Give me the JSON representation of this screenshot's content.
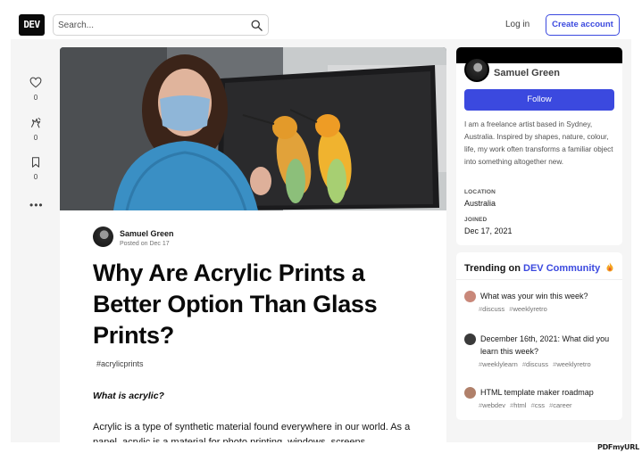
{
  "header": {
    "logo": "DEV",
    "search_placeholder": "Search...",
    "login_label": "Log in",
    "create_account_label": "Create account"
  },
  "reactions": [
    {
      "icon": "heart-icon",
      "count": "0"
    },
    {
      "icon": "unicorn-icon",
      "count": "0"
    },
    {
      "icon": "bookmark-icon",
      "count": "0"
    }
  ],
  "more_label": "•••",
  "article": {
    "author_name": "Samuel Green",
    "posted": "Posted on Dec 17",
    "title": "Why Are Acrylic Prints a Better Option Than Glass Prints?",
    "tag": "#acrylicprints",
    "subheading": "What is acrylic?",
    "body": "Acrylic is a type of synthetic material found everywhere in our world. As a panel, acrylic is a material for photo printing, windows, screens"
  },
  "profile": {
    "name": "Samuel Green",
    "follow_label": "Follow",
    "bio": "I am a freelance artist based in Sydney, Australia. Inspired by shapes, nature, colour, life, my work often transforms a familiar object into something altogether new.",
    "location_label": "LOCATION",
    "location": "Australia",
    "joined_label": "JOINED",
    "joined": "Dec 17, 2021"
  },
  "trending": {
    "prefix": "Trending on",
    "brand": "DEV Community",
    "items": [
      {
        "title": "What was your win this week?",
        "tags": [
          "discuss",
          "weeklyretro"
        ],
        "avatar_color": "#c9887a"
      },
      {
        "title": "December 16th, 2021: What did you learn this week?",
        "tags": [
          "weeklylearn",
          "discuss",
          "weeklyretro"
        ],
        "avatar_color": "#3a3a3a"
      },
      {
        "title": "HTML template maker roadmap",
        "tags": [
          "webdev",
          "html",
          "css",
          "career"
        ],
        "avatar_color": "#b0806a"
      }
    ]
  },
  "colors": {
    "accent": "#3b49df",
    "background": "#f5f5f5"
  },
  "watermark": "PDFmyURL"
}
